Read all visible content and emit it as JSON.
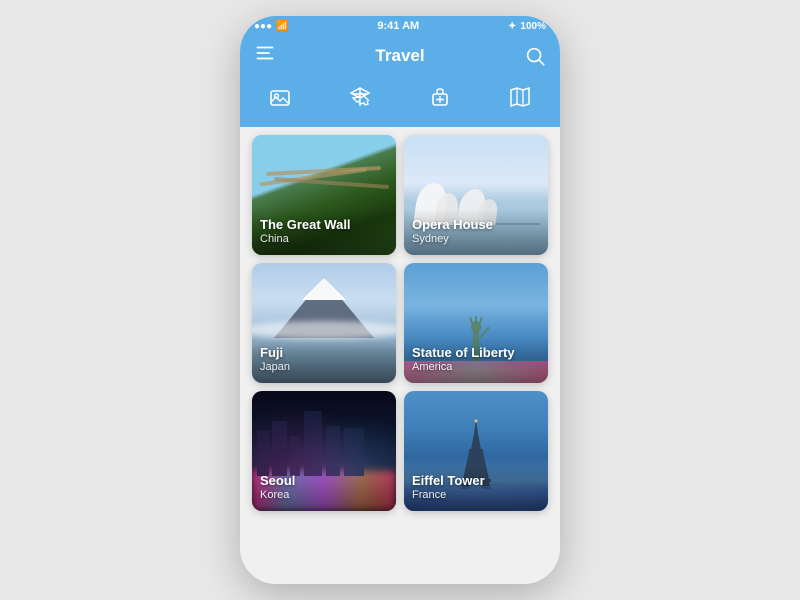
{
  "statusBar": {
    "signal": "●●●",
    "wifi": "wifi",
    "time": "9:41 AM",
    "bluetooth": "✦",
    "battery": "100%"
  },
  "header": {
    "title": "Travel",
    "menuIcon": "menu-icon",
    "searchIcon": "search-icon"
  },
  "navTabs": [
    {
      "id": "photos",
      "label": "⛰",
      "active": true
    },
    {
      "id": "flights",
      "label": "✈",
      "active": false
    },
    {
      "id": "luggage",
      "label": "🧳",
      "active": false
    },
    {
      "id": "map",
      "label": "🗺",
      "active": false
    }
  ],
  "cards": [
    {
      "id": "great-wall",
      "title": "The Great Wall",
      "subtitle": "China",
      "bg": "great-wall"
    },
    {
      "id": "opera-house",
      "title": "Opera House",
      "subtitle": "Sydney",
      "bg": "opera-house"
    },
    {
      "id": "fuji",
      "title": "Fuji",
      "subtitle": "Japan",
      "bg": "fuji"
    },
    {
      "id": "statue-of-liberty",
      "title": "Statue of Liberty",
      "subtitle": "America",
      "bg": "statue"
    },
    {
      "id": "seoul",
      "title": "Seoul",
      "subtitle": "Korea",
      "bg": "seoul"
    },
    {
      "id": "eiffel-tower",
      "title": "Eiffel Tower",
      "subtitle": "France",
      "bg": "eiffel"
    }
  ]
}
